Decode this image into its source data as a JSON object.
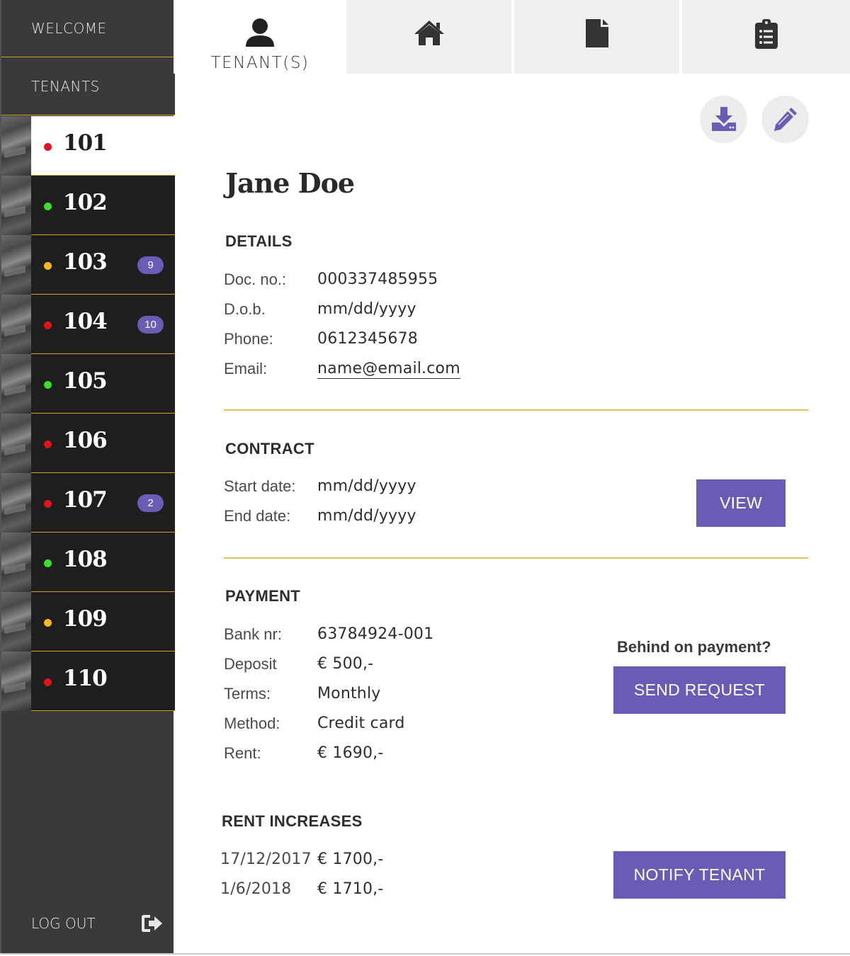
{
  "sidebar": {
    "welcome": "WELCOME",
    "tenants": "TENANTS",
    "units": [
      {
        "number": "101",
        "status": "red",
        "badge": ""
      },
      {
        "number": "102",
        "status": "green",
        "badge": ""
      },
      {
        "number": "103",
        "status": "yellow",
        "badge": "9"
      },
      {
        "number": "104",
        "status": "red",
        "badge": "10"
      },
      {
        "number": "105",
        "status": "green",
        "badge": ""
      },
      {
        "number": "106",
        "status": "red",
        "badge": ""
      },
      {
        "number": "107",
        "status": "red",
        "badge": "2"
      },
      {
        "number": "108",
        "status": "green",
        "badge": ""
      },
      {
        "number": "109",
        "status": "yellow",
        "badge": ""
      },
      {
        "number": "110",
        "status": "red",
        "badge": ""
      }
    ],
    "active_unit": "101",
    "logout": "LOG OUT"
  },
  "tabs": [
    {
      "label": "TENANT(S)",
      "icon": "user-icon",
      "active": true
    },
    {
      "label": "",
      "icon": "home-icon",
      "active": false
    },
    {
      "label": "",
      "icon": "document-icon",
      "active": false
    },
    {
      "label": "",
      "icon": "clipboard-list-icon",
      "active": false
    }
  ],
  "actions": {
    "download_icon": "download-icon",
    "edit_icon": "pencil-icon"
  },
  "tenant": {
    "name": "Jane Doe"
  },
  "details": {
    "title": "DETAILS",
    "doc_label": "Doc. no.:",
    "doc_value": "000337485955",
    "dob_label": "D.o.b.",
    "dob_value": "mm/dd/yyyy",
    "phone_label": "Phone:",
    "phone_value": "0612345678",
    "email_label": "Email:",
    "email_value": "name@email.com"
  },
  "contract": {
    "title": "CONTRACT",
    "start_label": "Start date:",
    "start_value": "mm/dd/yyyy",
    "end_label": "End date:",
    "end_value": "mm/dd/yyyy",
    "view_button": "VIEW"
  },
  "payment": {
    "title": "PAYMENT",
    "bank_label": "Bank nr:",
    "bank_value": "63784924-001",
    "deposit_label": "Deposit",
    "deposit_value": "€ 500,-",
    "terms_label": "Terms:",
    "terms_value": "Monthly",
    "method_label": "Method:",
    "method_value": "Credit card",
    "rent_label": "Rent:",
    "rent_value": "€ 1690,-",
    "behind_note": "Behind on payment?",
    "send_button": "SEND REQUEST"
  },
  "rent_increases": {
    "title": "RENT INCREASES",
    "rows": [
      {
        "date": "17/12/2017",
        "amount": "€ 1700,-"
      },
      {
        "date": "1/6/2018",
        "amount": "€ 1710,-"
      }
    ],
    "notify_button": "NOTIFY TENANT"
  },
  "colors": {
    "accent": "#6b5bb5",
    "divider": "#e3c25a",
    "sidebar_bg": "#3a3a3a",
    "unit_bg": "#1f1e1e",
    "status_red": "#e0141e",
    "status_green": "#3ddc2e",
    "status_yellow": "#f5b820"
  }
}
